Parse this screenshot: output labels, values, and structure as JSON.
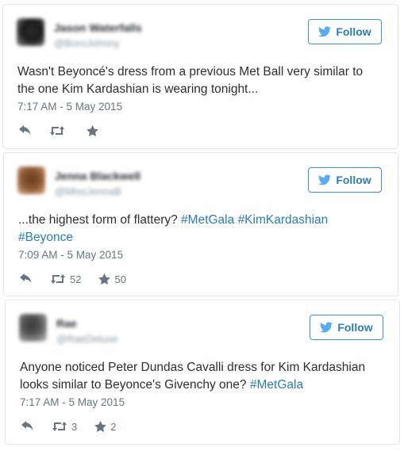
{
  "colors": {
    "link": "#2b7bb9",
    "follow_border": "#3b94d9",
    "text": "#292f33",
    "meta": "#66757f",
    "card_border": "#e1e8ed"
  },
  "icons": {
    "follow": "twitter-bird-icon",
    "reply": "reply-arrow-icon",
    "retweet": "retweet-icon",
    "favorite": "star-icon"
  },
  "tweets": [
    {
      "display_name": "Jason Waterfalls",
      "handle": "@BoroJohnny",
      "follow_label": "Follow",
      "text": "Wasn't Beyoncé's dress from a previous Met Ball very similar to the one Kim Kardashian is wearing tonight...",
      "timestamp": "7:17 AM - 5 May 2015",
      "retweets": "",
      "favorites": ""
    },
    {
      "display_name": "Jenna Blackwell",
      "handle": "@MissJennaB",
      "follow_label": "Follow",
      "text_prefix": "...the highest form of flattery? ",
      "hashtags": [
        "#MetGala",
        "#KimKardashian",
        "#Beyonce"
      ],
      "timestamp": "7:09 AM - 5 May 2015",
      "retweets": "52",
      "favorites": "50"
    },
    {
      "display_name": "Rae",
      "handle": "@RaeDeluxe",
      "follow_label": "Follow",
      "text_prefix": "Anyone noticed Peter Dundas Cavalli dress for Kim Kardashian looks similar to Beyonce's Givenchy one? ",
      "hashtags": [
        "#MetGala"
      ],
      "timestamp": "7:17 AM - 5 May 2015",
      "retweets": "3",
      "favorites": "2"
    }
  ]
}
